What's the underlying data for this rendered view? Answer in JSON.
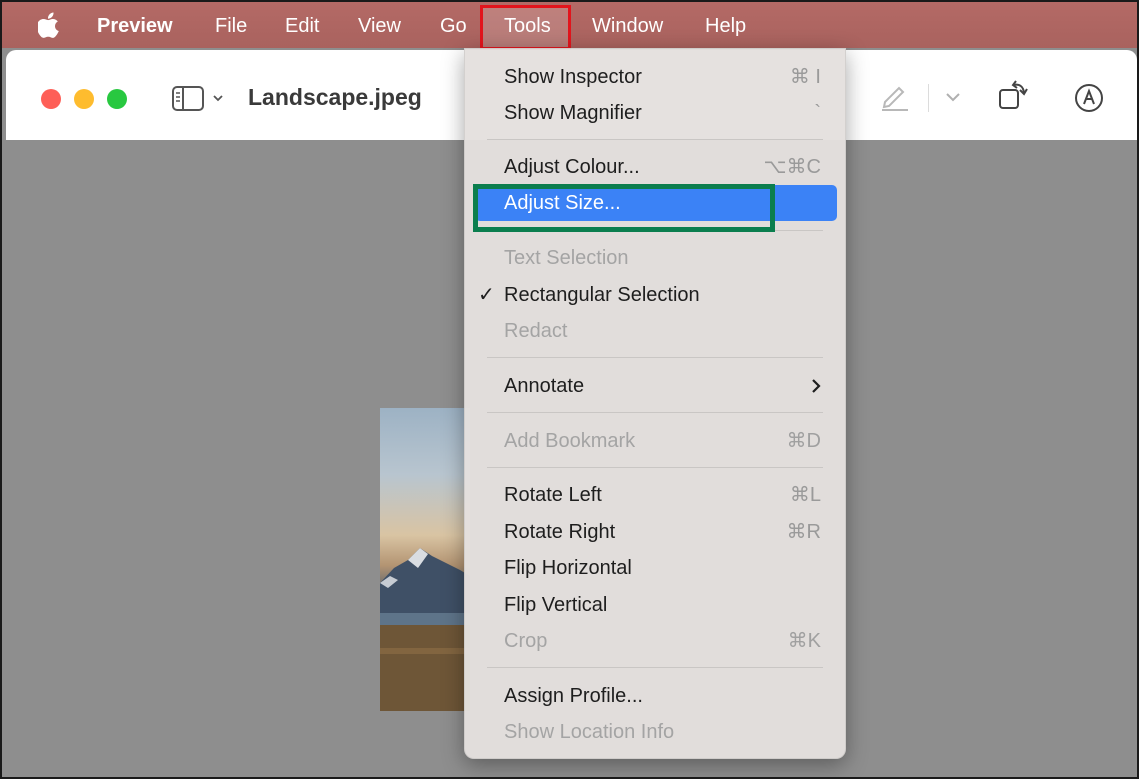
{
  "menubar": {
    "app_name": "Preview",
    "items": [
      "File",
      "Edit",
      "View",
      "Go",
      "Tools",
      "Window",
      "Help"
    ]
  },
  "window": {
    "title": "Landscape.jpeg"
  },
  "tools_menu": {
    "items": [
      {
        "label": "Show Inspector",
        "shortcut": "⌘ I",
        "enabled": true
      },
      {
        "label": "Show Magnifier",
        "shortcut": "`",
        "enabled": true
      },
      {
        "label": "Adjust Colour...",
        "shortcut": "⌥⌘C",
        "enabled": true
      },
      {
        "label": "Adjust Size...",
        "shortcut": "",
        "enabled": true,
        "highlighted": true
      },
      {
        "label": "Text Selection",
        "shortcut": "",
        "enabled": false
      },
      {
        "label": "Rectangular Selection",
        "shortcut": "",
        "enabled": true,
        "checked": true
      },
      {
        "label": "Redact",
        "shortcut": "",
        "enabled": false
      },
      {
        "label": "Annotate",
        "shortcut": "",
        "enabled": true,
        "submenu": true
      },
      {
        "label": "Add Bookmark",
        "shortcut": "⌘D",
        "enabled": false
      },
      {
        "label": "Rotate Left",
        "shortcut": "⌘L",
        "enabled": true
      },
      {
        "label": "Rotate Right",
        "shortcut": "⌘R",
        "enabled": true
      },
      {
        "label": "Flip Horizontal",
        "shortcut": "",
        "enabled": true
      },
      {
        "label": "Flip Vertical",
        "shortcut": "",
        "enabled": true
      },
      {
        "label": "Crop",
        "shortcut": "⌘K",
        "enabled": false
      },
      {
        "label": "Assign Profile...",
        "shortcut": "",
        "enabled": true
      },
      {
        "label": "Show Location Info",
        "shortcut": "",
        "enabled": false
      }
    ]
  },
  "colors": {
    "menubar": "#a9625e",
    "highlight": "#3b82f6",
    "tools_annotation": "#e2141c",
    "adjust_size_annotation": "#0b7e4e"
  }
}
